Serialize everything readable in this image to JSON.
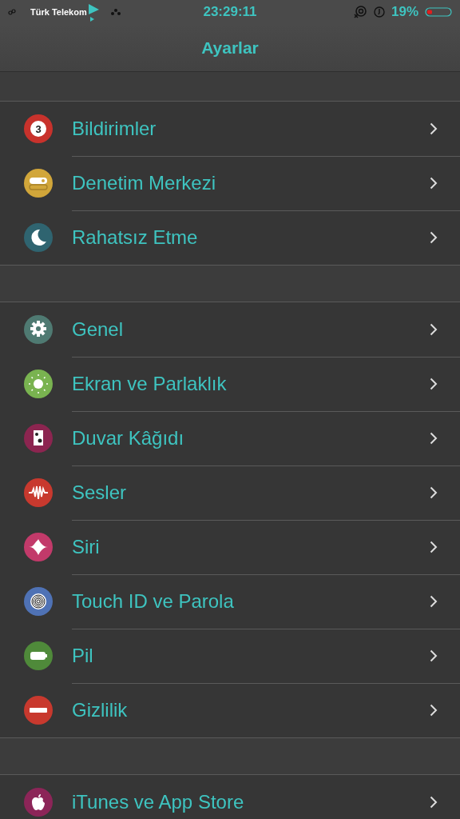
{
  "status_bar": {
    "carrier": "Türk Telekom",
    "time": "23:29:11",
    "battery": "19%"
  },
  "nav_bar": {
    "title": "Ayarlar"
  },
  "groups": [
    {
      "items": [
        {
          "label": "Bildirimler",
          "kind": "badge",
          "icon_text": "3",
          "color": "#c8322c"
        },
        {
          "label": "Denetim Merkezi",
          "kind": "toggle",
          "color": "#d1a63a"
        },
        {
          "label": "Rahatsız Etme",
          "kind": "moon",
          "color": "#2f6470"
        }
      ]
    },
    {
      "items": [
        {
          "label": "Genel",
          "kind": "gear",
          "color": "#4f7a72"
        },
        {
          "label": "Ekran ve Parlaklık",
          "kind": "sun",
          "color": "#79b350"
        },
        {
          "label": "Duvar Kâğıdı",
          "kind": "wallpaper",
          "color": "#8c2550"
        },
        {
          "label": "Sesler",
          "kind": "wave",
          "color": "#c8392e"
        },
        {
          "label": "Siri",
          "kind": "siri",
          "color": "#c23a6a"
        },
        {
          "label": "Touch ID ve Parola",
          "kind": "fingerprint",
          "color": "#4f72b5"
        },
        {
          "label": "Pil",
          "kind": "battery",
          "color": "#4f8a3a"
        },
        {
          "label": "Gizlilik",
          "kind": "minus",
          "color": "#c8392e"
        }
      ]
    },
    {
      "items": [
        {
          "label": "iTunes ve App Store",
          "kind": "apple",
          "color": "#8c2558"
        }
      ]
    }
  ]
}
